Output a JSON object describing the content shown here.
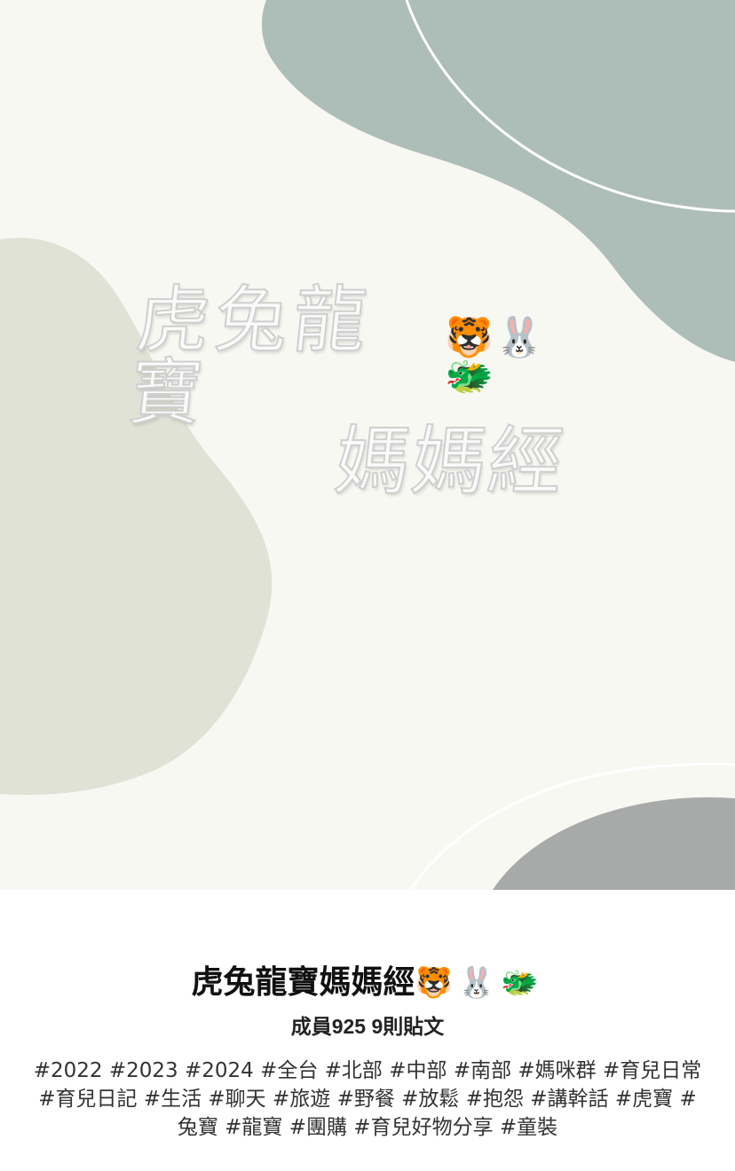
{
  "cover": {
    "title_line_1": "虎兔龍寶",
    "title_emoji": "🐯🐰🐲",
    "title_line_2": "媽媽經",
    "colors": {
      "background": "#f8f8f3",
      "blob_top_right": "#adbdb8",
      "blob_left": "#dfe2d5",
      "blob_bottom_right": "#a7aaa8",
      "line": "#ffffff"
    }
  },
  "group": {
    "name": "虎兔龍寶媽媽經",
    "name_emoji": "🐯🐰🐲",
    "stats": "成員925 9則貼文",
    "tags": "#2022 #2023 #2024 #全台 #北部 #中部 #南部 #媽咪群 #育兒日常 #育兒日記 #生活 #聊天 #旅遊 #野餐 #放鬆 #抱怨 #講幹話 #虎寶 #兔寶 #龍寶 #團購 #育兒好物分享 #童裝"
  }
}
